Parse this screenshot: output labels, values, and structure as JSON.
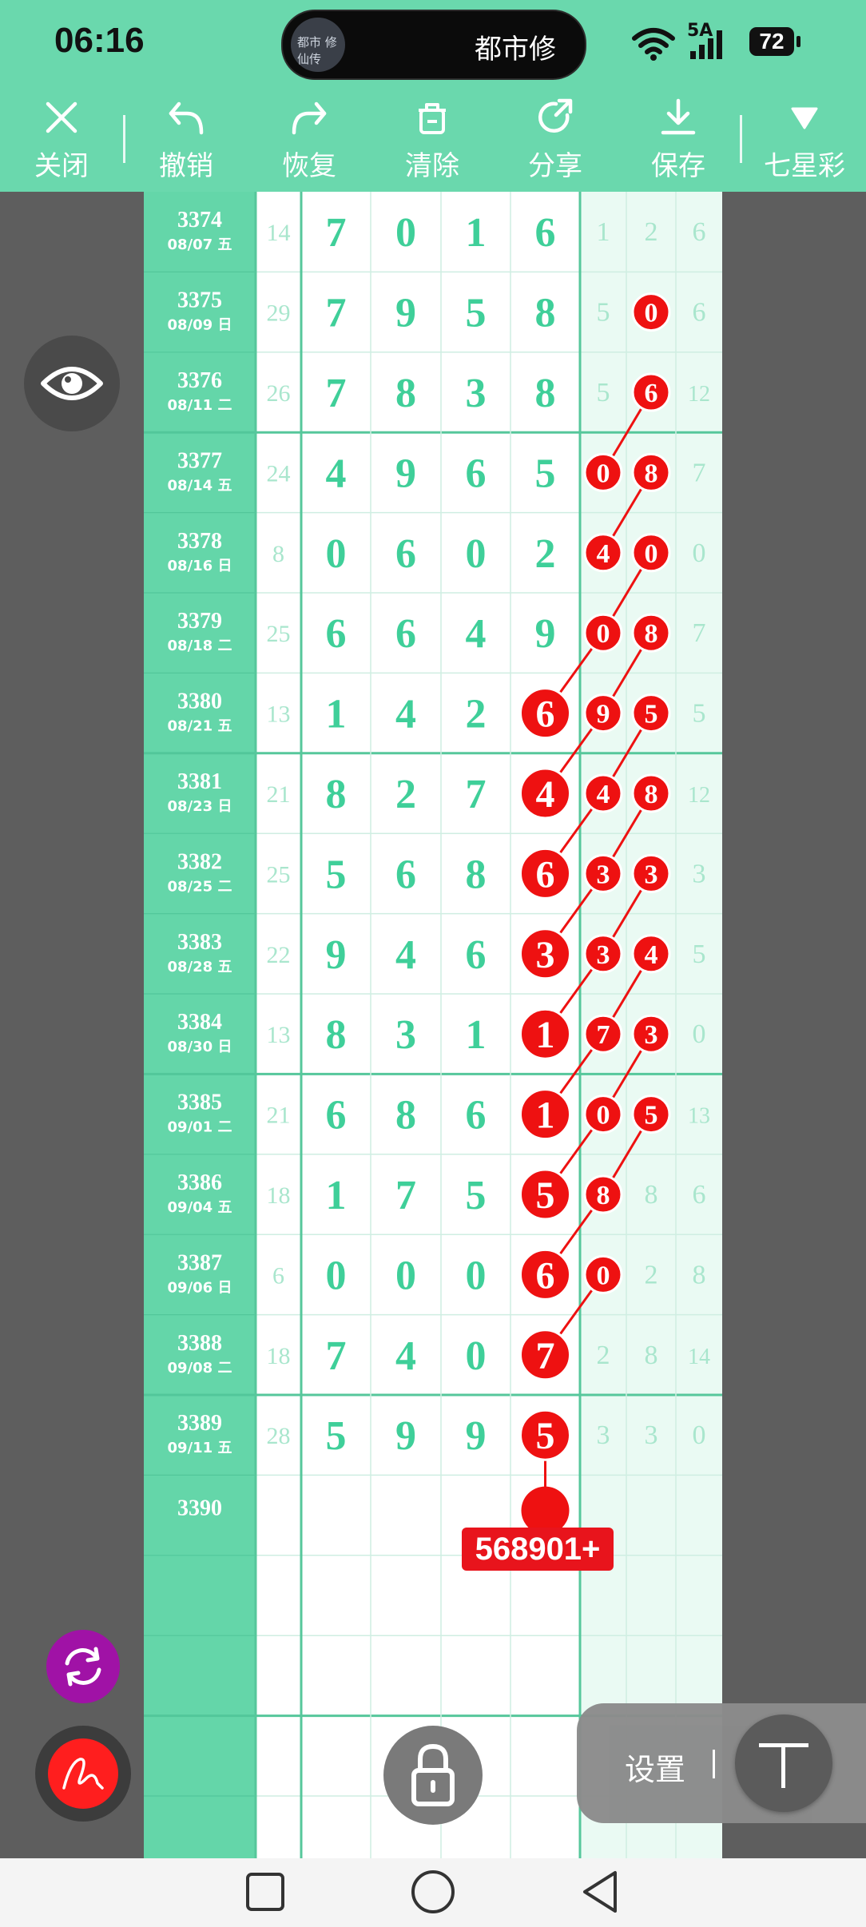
{
  "status_bar": {
    "time": "06:16",
    "song_title": "都市修",
    "album_art_text": "都市\n修仙传",
    "network": "5A",
    "battery": "72"
  },
  "toolbar": {
    "items": [
      {
        "label": "关闭",
        "icon": "close-icon"
      },
      {
        "label": "撤销",
        "icon": "undo-icon"
      },
      {
        "label": "恢复",
        "icon": "redo-icon"
      },
      {
        "label": "清除",
        "icon": "trash-icon"
      },
      {
        "label": "分享",
        "icon": "share-icon"
      },
      {
        "label": "保存",
        "icon": "download-icon"
      }
    ],
    "lottery_selector": "七星彩",
    "selector_icon": "triangle-down-icon"
  },
  "table": {
    "rows": [
      {
        "issue": "3374",
        "date": "08/07 五",
        "sum": "14",
        "main": [
          "7",
          "0",
          "1",
          "6"
        ],
        "tail": [
          "1",
          "2",
          "6"
        ]
      },
      {
        "issue": "3375",
        "date": "08/09 日",
        "sum": "29",
        "main": [
          "7",
          "9",
          "5",
          "8"
        ],
        "tail": [
          "5",
          "0",
          "6"
        ]
      },
      {
        "issue": "3376",
        "date": "08/11 二",
        "sum": "26",
        "main": [
          "7",
          "8",
          "3",
          "8"
        ],
        "tail": [
          "5",
          "6",
          "12"
        ]
      },
      {
        "issue": "3377",
        "date": "08/14 五",
        "sum": "24",
        "main": [
          "4",
          "9",
          "6",
          "5"
        ],
        "tail": [
          "0",
          "8",
          "7"
        ]
      },
      {
        "issue": "3378",
        "date": "08/16 日",
        "sum": "8",
        "main": [
          "0",
          "6",
          "0",
          "2"
        ],
        "tail": [
          "4",
          "0",
          "0"
        ]
      },
      {
        "issue": "3379",
        "date": "08/18 二",
        "sum": "25",
        "main": [
          "6",
          "6",
          "4",
          "9"
        ],
        "tail": [
          "0",
          "8",
          "7"
        ]
      },
      {
        "issue": "3380",
        "date": "08/21 五",
        "sum": "13",
        "main": [
          "1",
          "4",
          "2",
          "6"
        ],
        "tail": [
          "9",
          "5",
          "5"
        ]
      },
      {
        "issue": "3381",
        "date": "08/23 日",
        "sum": "21",
        "main": [
          "8",
          "2",
          "7",
          "4"
        ],
        "tail": [
          "4",
          "8",
          "12"
        ]
      },
      {
        "issue": "3382",
        "date": "08/25 二",
        "sum": "25",
        "main": [
          "5",
          "6",
          "8",
          "6"
        ],
        "tail": [
          "3",
          "3",
          "3"
        ]
      },
      {
        "issue": "3383",
        "date": "08/28 五",
        "sum": "22",
        "main": [
          "9",
          "4",
          "6",
          "3"
        ],
        "tail": [
          "3",
          "4",
          "5"
        ]
      },
      {
        "issue": "3384",
        "date": "08/30 日",
        "sum": "13",
        "main": [
          "8",
          "3",
          "1",
          "1"
        ],
        "tail": [
          "7",
          "3",
          "0"
        ]
      },
      {
        "issue": "3385",
        "date": "09/01 二",
        "sum": "21",
        "main": [
          "6",
          "8",
          "6",
          "1"
        ],
        "tail": [
          "0",
          "5",
          "13"
        ]
      },
      {
        "issue": "3386",
        "date": "09/04 五",
        "sum": "18",
        "main": [
          "1",
          "7",
          "5",
          "5"
        ],
        "tail": [
          "8",
          "8",
          "6"
        ]
      },
      {
        "issue": "3387",
        "date": "09/06 日",
        "sum": "6",
        "main": [
          "0",
          "0",
          "0",
          "6"
        ],
        "tail": [
          "0",
          "2",
          "8"
        ]
      },
      {
        "issue": "3388",
        "date": "09/08 二",
        "sum": "18",
        "main": [
          "7",
          "4",
          "0",
          "7"
        ],
        "tail": [
          "2",
          "8",
          "14"
        ]
      },
      {
        "issue": "3389",
        "date": "09/11 五",
        "sum": "28",
        "main": [
          "5",
          "9",
          "9",
          "5"
        ],
        "tail": [
          "3",
          "3",
          "0"
        ]
      },
      {
        "issue": "3390",
        "date": "",
        "sum": "",
        "main": [
          "",
          "",
          "",
          ""
        ],
        "tail": [
          "",
          "",
          ""
        ]
      }
    ],
    "highlighted": [
      [
        1,
        7
      ],
      [
        2,
        7
      ],
      [
        3,
        6
      ],
      [
        3,
        7
      ],
      [
        4,
        6
      ],
      [
        4,
        7
      ],
      [
        5,
        6
      ],
      [
        5,
        7
      ],
      [
        6,
        5
      ],
      [
        6,
        6
      ],
      [
        6,
        7
      ],
      [
        7,
        5
      ],
      [
        7,
        6
      ],
      [
        7,
        7
      ],
      [
        8,
        5
      ],
      [
        8,
        6
      ],
      [
        8,
        7
      ],
      [
        9,
        5
      ],
      [
        9,
        6
      ],
      [
        9,
        7
      ],
      [
        10,
        5
      ],
      [
        10,
        6
      ],
      [
        10,
        7
      ],
      [
        11,
        5
      ],
      [
        11,
        6
      ],
      [
        11,
        7
      ],
      [
        12,
        5
      ],
      [
        12,
        6
      ],
      [
        13,
        5
      ],
      [
        13,
        6
      ],
      [
        14,
        5
      ],
      [
        15,
        5
      ]
    ],
    "prediction": "568901+"
  },
  "floating": {
    "eye_icon": "eye-icon",
    "sync_icon": "sync-icon",
    "pen_icon": "pen-icon",
    "lock_icon": "lock-icon",
    "settings_label": "设置",
    "text_tool_icon": "text-icon"
  },
  "nav": {
    "icons": [
      "recent-apps-icon",
      "home-icon",
      "back-icon"
    ]
  },
  "colors": {
    "accent": "#6ad8ad",
    "issue_column": "#64d6a9",
    "tail_bg": "#eafaf3",
    "digit": "#3fcf99",
    "highlight": "#ee1111"
  }
}
